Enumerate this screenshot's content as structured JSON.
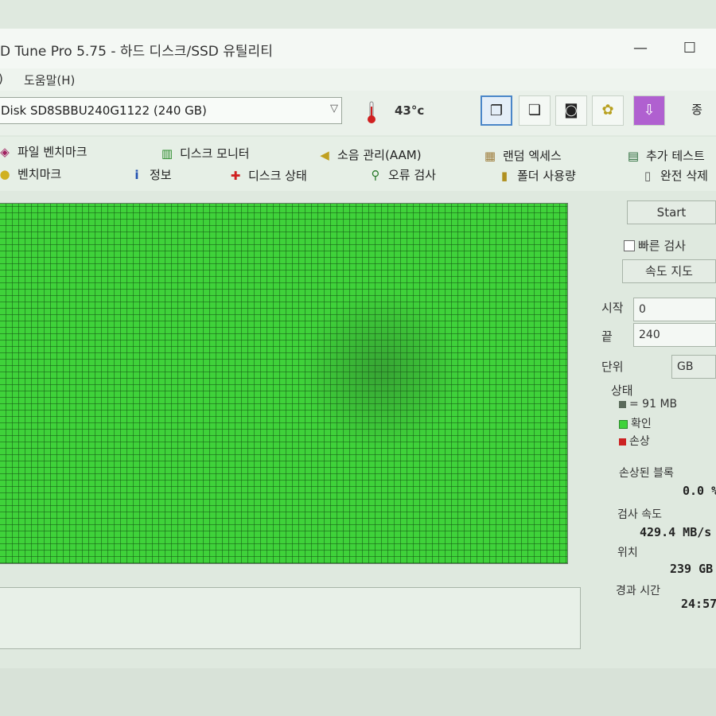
{
  "window": {
    "title": "D Tune Pro 5.75 - 하드 디스크/SSD 유틸리티",
    "minimize_label": "—",
    "maximize_label": "☐"
  },
  "menu": {
    "items": [
      ")",
      "도움말(H)"
    ]
  },
  "toolbar": {
    "drive": "Disk SD8SBBU240G1122 (240 GB)",
    "temperature": "43°c",
    "cut_text": "종"
  },
  "tabs": {
    "row1": [
      "파일 벤치마크",
      "디스크 모니터",
      "소음 관리(AAM)",
      "랜덤 엑세스",
      "추가 테스트"
    ],
    "row2": [
      "벤치마크",
      "정보",
      "디스크 상태",
      "오류 검사",
      "폴더 사용량",
      "완전 삭제"
    ]
  },
  "side": {
    "start_button": "Start",
    "quick_scan_label": "빠른 검사",
    "speed_map_button": "속도 지도",
    "start_label": "시작",
    "start_value": "0",
    "end_label": "끝",
    "end_value": "240",
    "unit_label": "단위",
    "unit_value": "GB",
    "status_label": "상태",
    "legend_block": "= 91 MB",
    "legend_ok": "확인",
    "legend_damaged": "손상",
    "damaged_blocks_label": "손상된 블록",
    "damaged_blocks_value": "0.0 %",
    "scan_speed_label": "검사 속도",
    "scan_speed_value": "429.4 MB/s",
    "position_label": "위치",
    "position_value": "239 GB",
    "elapsed_label": "경과 시간",
    "elapsed_value": "24:57"
  },
  "colors": {
    "block_ok": "#3fd23a",
    "block_damaged": "#cc2222",
    "block_unit": "#5a6a5a"
  }
}
